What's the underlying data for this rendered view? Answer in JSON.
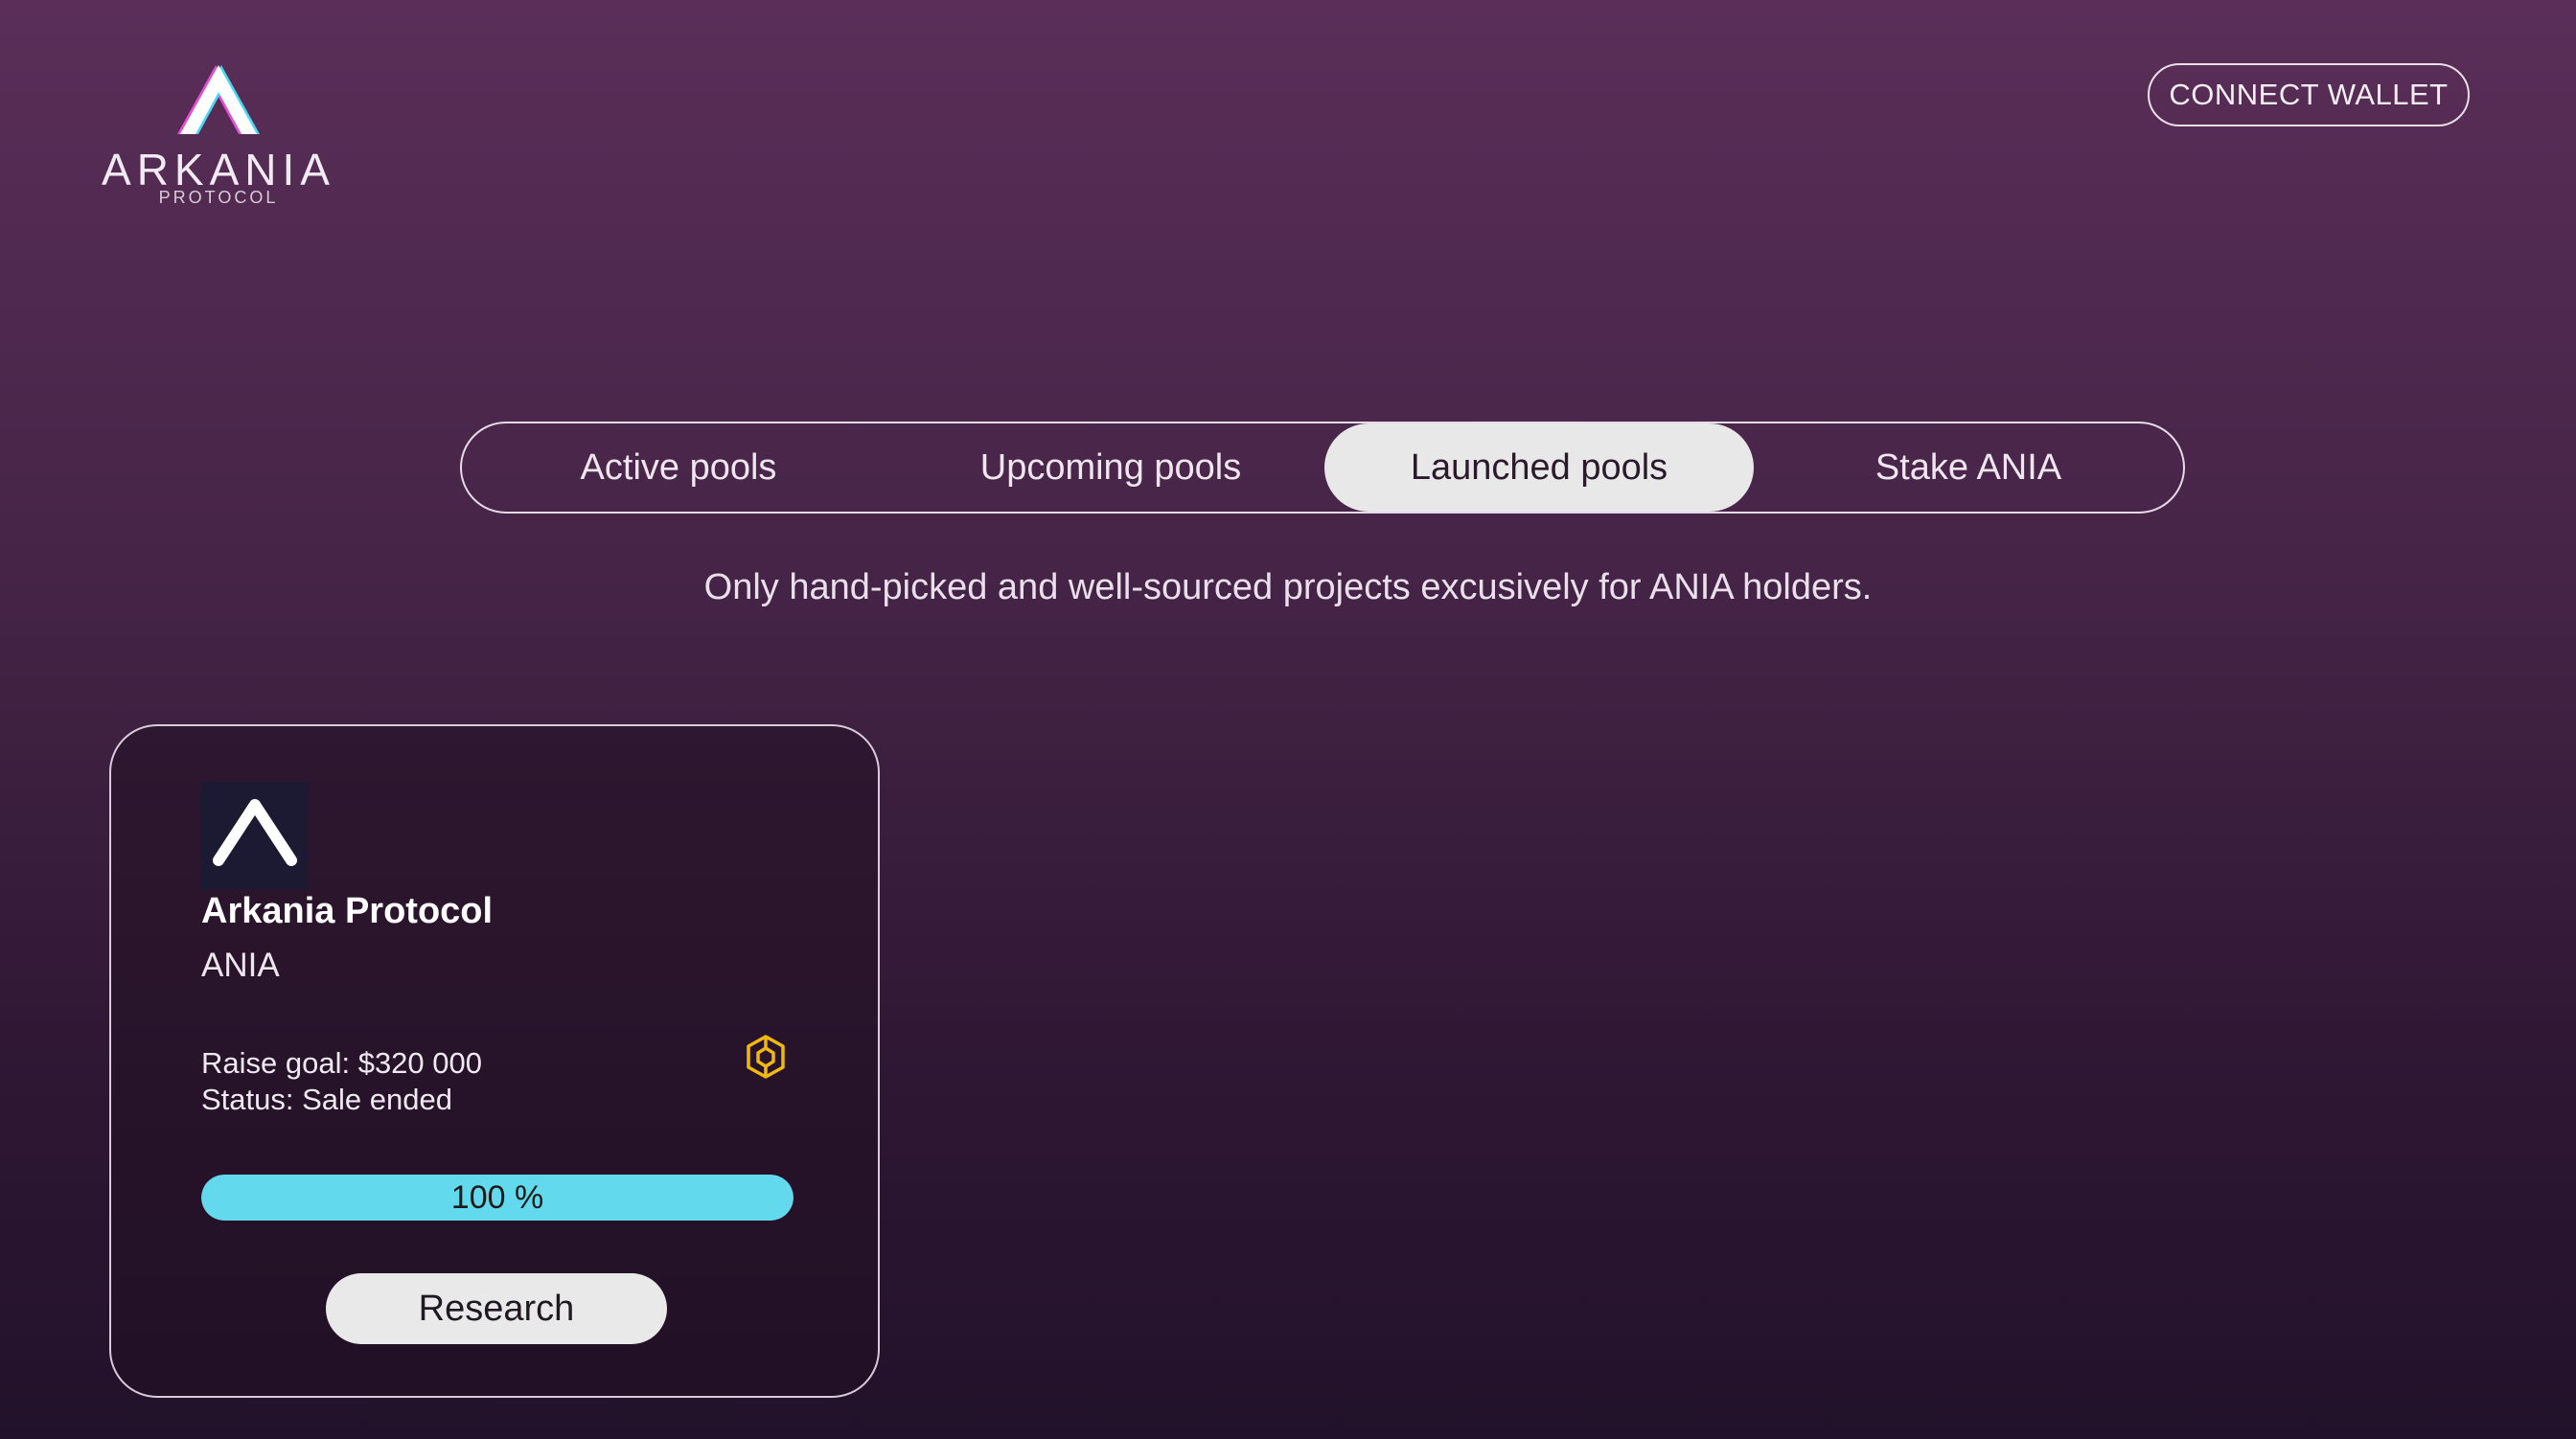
{
  "brand": {
    "name": "ARKANIA",
    "sub": "PROTOCOL"
  },
  "header": {
    "connect_label": "CONNECT WALLET"
  },
  "tabs": [
    {
      "label": "Active pools",
      "active": false
    },
    {
      "label": "Upcoming pools",
      "active": false
    },
    {
      "label": "Launched pools",
      "active": true
    },
    {
      "label": "Stake ANIA",
      "active": false
    }
  ],
  "tagline": "Only hand-picked and well-sourced projects excusively for ANIA holders.",
  "pools": [
    {
      "name": "Arkania Protocol",
      "ticker": "ANIA",
      "raise_goal": "Raise goal: $320 000",
      "status": "Status: Sale ended",
      "progress_percent": 100,
      "progress_label": "100 %",
      "research_label": "Research",
      "chain_icon": "bnb-chain-icon"
    }
  ],
  "colors": {
    "accent": "#63d9ee",
    "chain": "#f0b90b",
    "tab_active_bg": "#e8e8e8"
  }
}
